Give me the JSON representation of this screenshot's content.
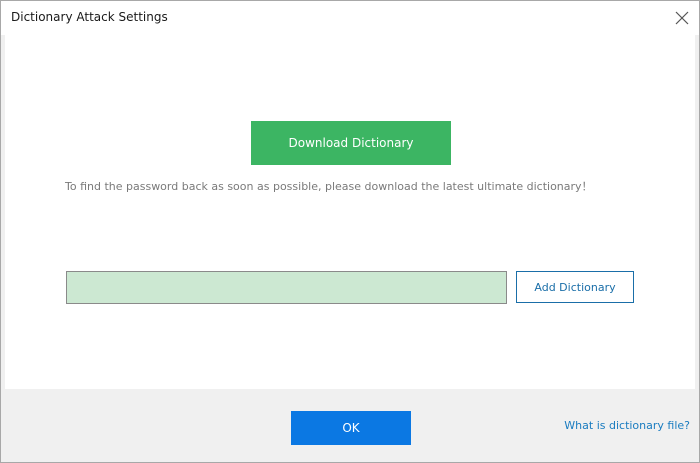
{
  "window": {
    "title": "Dictionary Attack Settings",
    "close_icon": "close-icon"
  },
  "main": {
    "download_label": "Download Dictionary",
    "hint_text": "To find the password back as soon as possible, please download the latest ultimate dictionary！",
    "dictionary_input": {
      "value": "",
      "placeholder": ""
    },
    "add_label": "Add Dictionary"
  },
  "footer": {
    "ok_label": "OK",
    "help_link": "What is dictionary file?"
  },
  "colors": {
    "download_button": "#3cb563",
    "ok_button": "#0b78e3",
    "input_background": "#cce8d2",
    "link": "#1a7cc0"
  }
}
